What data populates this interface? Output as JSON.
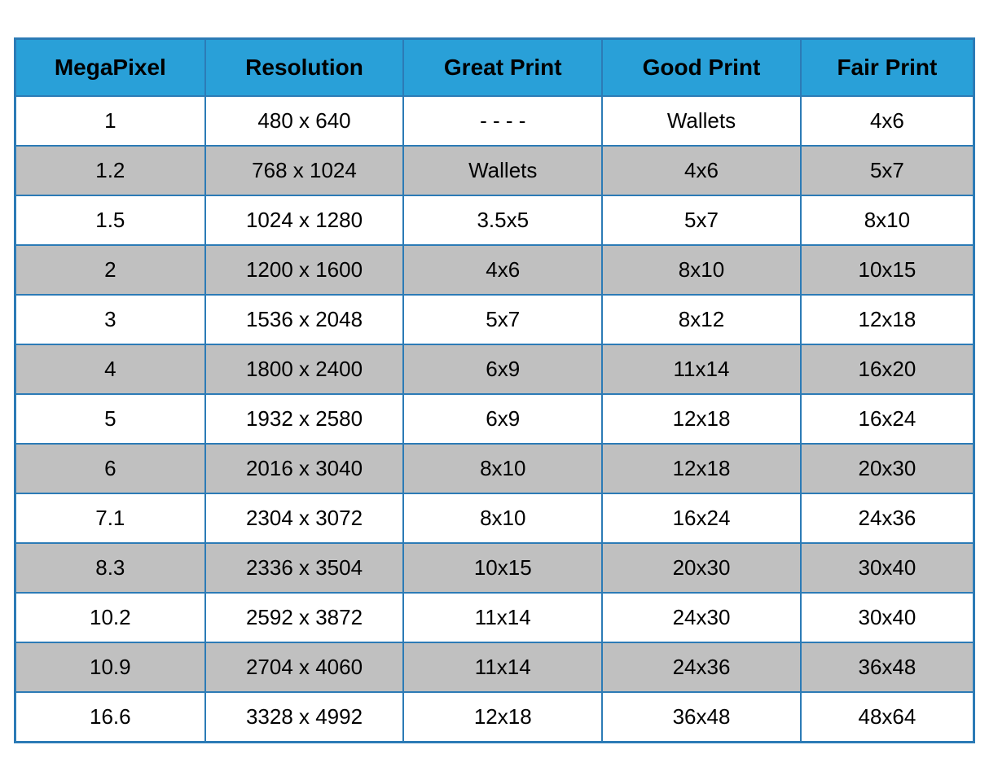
{
  "table": {
    "headers": [
      "MegaPixel",
      "Resolution",
      "Great Print",
      "Good Print",
      "Fair Print"
    ],
    "rows": [
      {
        "megapixel": "1",
        "resolution": "480 x 640",
        "great": "- - - -",
        "good": "Wallets",
        "fair": "4x6"
      },
      {
        "megapixel": "1.2",
        "resolution": "768 x 1024",
        "great": "Wallets",
        "good": "4x6",
        "fair": "5x7"
      },
      {
        "megapixel": "1.5",
        "resolution": "1024 x 1280",
        "great": "3.5x5",
        "good": "5x7",
        "fair": "8x10"
      },
      {
        "megapixel": "2",
        "resolution": "1200 x 1600",
        "great": "4x6",
        "good": "8x10",
        "fair": "10x15"
      },
      {
        "megapixel": "3",
        "resolution": "1536 x 2048",
        "great": "5x7",
        "good": "8x12",
        "fair": "12x18"
      },
      {
        "megapixel": "4",
        "resolution": "1800 x 2400",
        "great": "6x9",
        "good": "11x14",
        "fair": "16x20"
      },
      {
        "megapixel": "5",
        "resolution": "1932 x 2580",
        "great": "6x9",
        "good": "12x18",
        "fair": "16x24"
      },
      {
        "megapixel": "6",
        "resolution": "2016 x 3040",
        "great": "8x10",
        "good": "12x18",
        "fair": "20x30"
      },
      {
        "megapixel": "7.1",
        "resolution": "2304 x 3072",
        "great": "8x10",
        "good": "16x24",
        "fair": "24x36"
      },
      {
        "megapixel": "8.3",
        "resolution": "2336 x 3504",
        "great": "10x15",
        "good": "20x30",
        "fair": "30x40"
      },
      {
        "megapixel": "10.2",
        "resolution": "2592 x 3872",
        "great": "11x14",
        "good": "24x30",
        "fair": "30x40"
      },
      {
        "megapixel": "10.9",
        "resolution": "2704 x 4060",
        "great": "11x14",
        "good": "24x36",
        "fair": "36x48"
      },
      {
        "megapixel": "16.6",
        "resolution": "3328 x 4992",
        "great": "12x18",
        "good": "36x48",
        "fair": "48x64"
      }
    ]
  }
}
